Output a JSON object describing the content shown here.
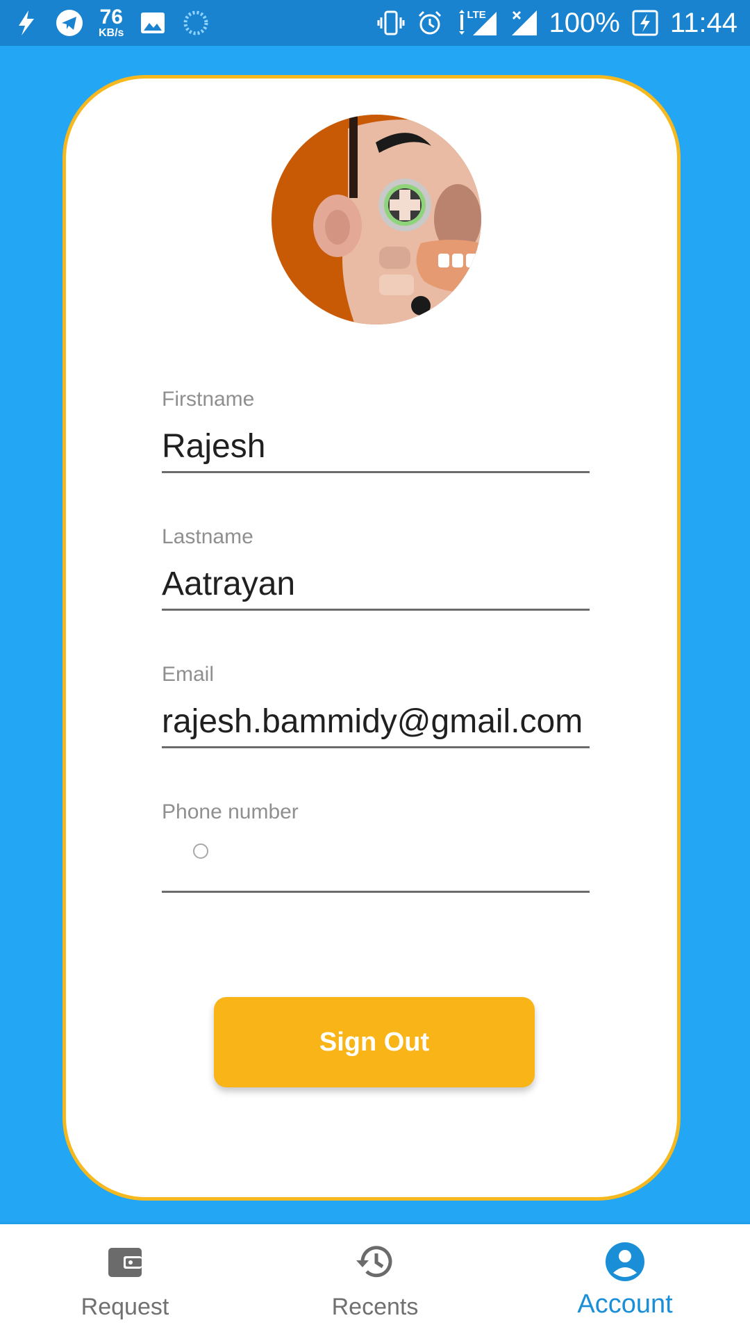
{
  "status_bar": {
    "net_speed_value": "76",
    "net_speed_unit": "KB/s",
    "network_label": "LTE",
    "battery": "100%",
    "time": "11:44"
  },
  "profile": {
    "firstname": {
      "label": "Firstname",
      "value": "Rajesh"
    },
    "lastname": {
      "label": "Lastname",
      "value": "Aatrayan"
    },
    "email": {
      "label": "Email",
      "value": "rajesh.bammidy@gmail.com"
    },
    "phone": {
      "label": "Phone number",
      "value": ""
    },
    "signout_label": "Sign Out"
  },
  "bottom_nav": {
    "items": [
      {
        "label": "Request",
        "icon": "wallet-icon",
        "active": false
      },
      {
        "label": "Recents",
        "icon": "history-icon",
        "active": false
      },
      {
        "label": "Account",
        "icon": "account-circle-icon",
        "active": true
      }
    ]
  },
  "colors": {
    "background": "#23a6f4",
    "status_bar": "#1a83d0",
    "accent_yellow": "#f9b418",
    "active_nav": "#1a8fd8"
  }
}
